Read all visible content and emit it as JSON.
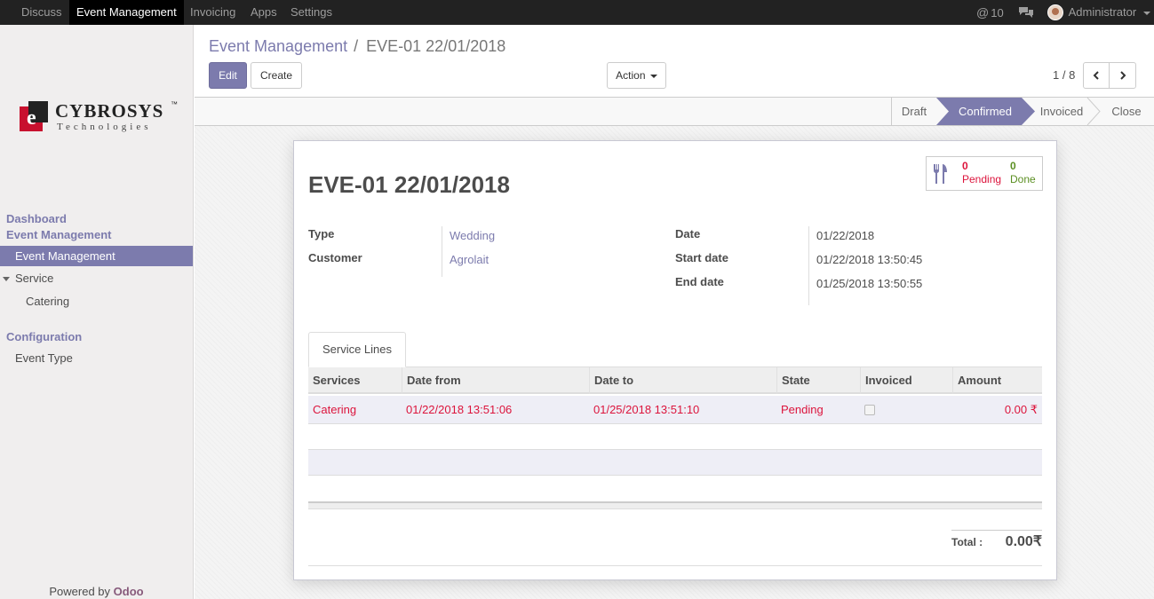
{
  "topbar": {
    "menus": [
      "Discuss",
      "Event Management",
      "Invoicing",
      "Apps",
      "Settings"
    ],
    "active_menu": "Event Management",
    "mentions_count": "10",
    "user": "Administrator"
  },
  "sidebar": {
    "logo_name": "CYBROSYS",
    "logo_tm": "™",
    "logo_sub": "Technologies",
    "dashboard": "Dashboard",
    "event_mgmt_header": "Event Management",
    "event_mgmt_item": "Event Management",
    "service": "Service",
    "catering": "Catering",
    "configuration": "Configuration",
    "event_type": "Event Type",
    "powered_by": "Powered by",
    "odoo": "Odoo"
  },
  "control_panel": {
    "breadcrumb_parent": "Event Management",
    "breadcrumb_sep": "/",
    "breadcrumb_current": "EVE-01 22/01/2018",
    "edit_label": "Edit",
    "create_label": "Create",
    "action_label": "Action",
    "pager": "1 / 8"
  },
  "status": {
    "stages": [
      "Draft",
      "Confirmed",
      "Invoiced",
      "Close"
    ],
    "active": "Confirmed"
  },
  "form": {
    "title": "EVE-01 22/01/2018",
    "smart_button": {
      "pending_count": "0",
      "pending_label": "Pending",
      "done_count": "0",
      "done_label": "Done"
    },
    "type_label": "Type",
    "type_value": "Wedding",
    "customer_label": "Customer",
    "customer_value": "Agrolait",
    "date_label": "Date",
    "date_value": "01/22/2018",
    "start_label": "Start date",
    "start_value": "01/22/2018 13:50:45",
    "end_label": "End date",
    "end_value": "01/25/2018 13:50:55",
    "tab_label": "Service Lines",
    "columns": [
      "Services",
      "Date from",
      "Date to",
      "State",
      "Invoiced",
      "Amount"
    ],
    "row": {
      "service": "Catering",
      "date_from": "01/22/2018 13:51:06",
      "date_to": "01/25/2018 13:51:10",
      "state": "Pending",
      "invoiced": false,
      "amount": "0.00 ₹"
    },
    "total_label": "Total :",
    "total_value": "0.00₹"
  },
  "colors": {
    "accent": "#7c7bad",
    "topbar": "#222222",
    "pending": "#dc143c",
    "done": "#5b8f22"
  }
}
